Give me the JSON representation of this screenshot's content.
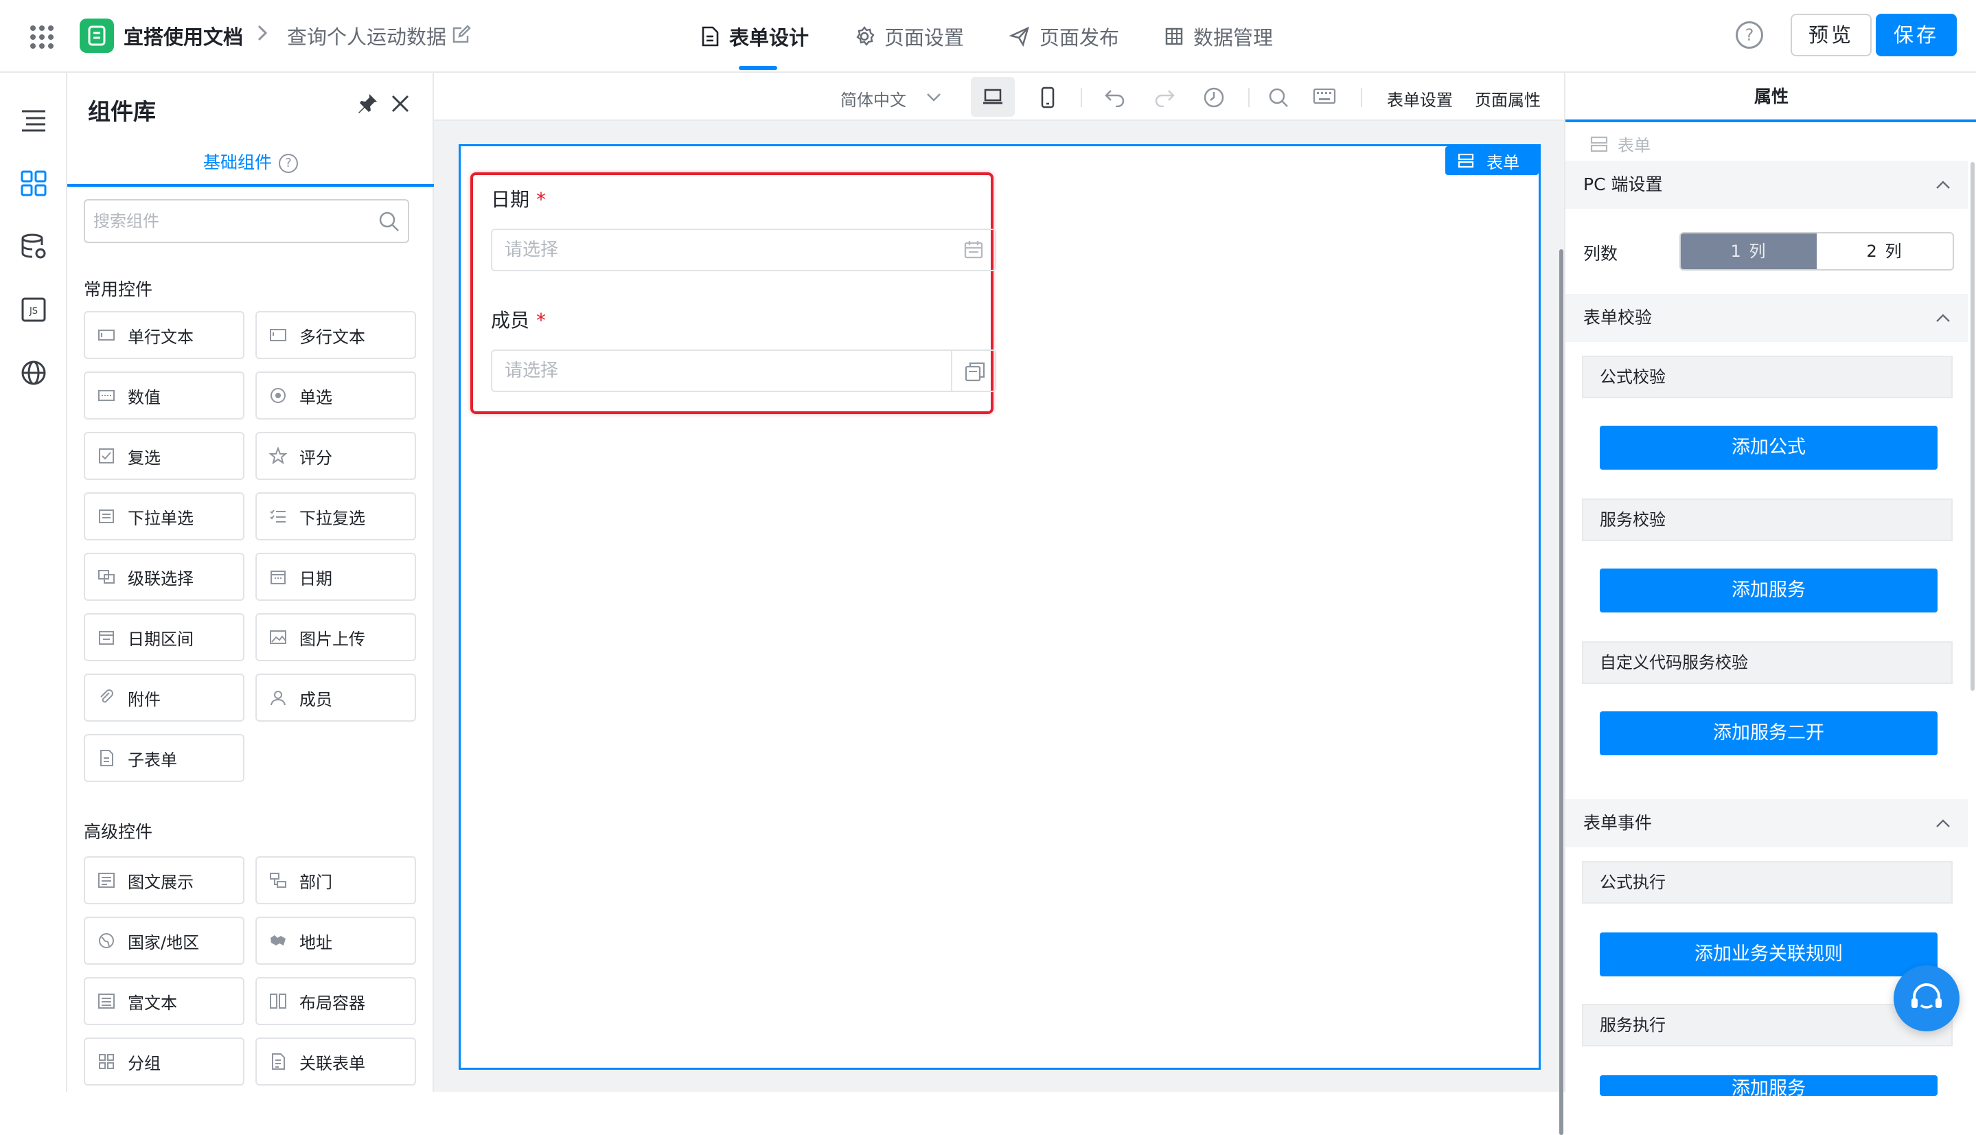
{
  "header": {
    "app_name": "宜搭使用文档",
    "breadcrumb_sep": ">",
    "page_name": "查询个人运动数据",
    "tabs": [
      {
        "label": "表单设计",
        "icon": "document-icon"
      },
      {
        "label": "页面设置",
        "icon": "gear-icon"
      },
      {
        "label": "页面发布",
        "icon": "send-icon"
      },
      {
        "label": "数据管理",
        "icon": "table-icon"
      }
    ],
    "help": "?",
    "preview_label": "预览",
    "save_label": "保存"
  },
  "rail": {
    "icons": [
      "outline-icon",
      "components-icon",
      "datasource-icon",
      "js-icon",
      "globe-icon"
    ]
  },
  "components": {
    "title": "组件库",
    "tab": "基础组件",
    "search_placeholder": "搜索组件",
    "common_title": "常用控件",
    "common": [
      {
        "label": "单行文本",
        "icon": "text-input-icon"
      },
      {
        "label": "多行文本",
        "icon": "textarea-icon"
      },
      {
        "label": "数值",
        "icon": "number-icon"
      },
      {
        "label": "单选",
        "icon": "radio-icon"
      },
      {
        "label": "复选",
        "icon": "checkbox-icon"
      },
      {
        "label": "评分",
        "icon": "star-icon"
      },
      {
        "label": "下拉单选",
        "icon": "select-icon"
      },
      {
        "label": "下拉复选",
        "icon": "multi-select-icon"
      },
      {
        "label": "级联选择",
        "icon": "cascade-icon"
      },
      {
        "label": "日期",
        "icon": "calendar-icon"
      },
      {
        "label": "日期区间",
        "icon": "date-range-icon"
      },
      {
        "label": "图片上传",
        "icon": "image-icon"
      },
      {
        "label": "附件",
        "icon": "attachment-icon"
      },
      {
        "label": "成员",
        "icon": "user-icon"
      },
      {
        "label": "子表单",
        "icon": "subform-icon"
      }
    ],
    "advanced_title": "高级控件",
    "advanced": [
      {
        "label": "图文展示",
        "icon": "image-text-icon"
      },
      {
        "label": "部门",
        "icon": "department-icon"
      },
      {
        "label": "国家/地区",
        "icon": "globe-icon"
      },
      {
        "label": "地址",
        "icon": "map-icon"
      },
      {
        "label": "富文本",
        "icon": "richtext-icon"
      },
      {
        "label": "布局容器",
        "icon": "layout-icon"
      },
      {
        "label": "分组",
        "icon": "group-icon"
      },
      {
        "label": "关联表单",
        "icon": "link-form-icon"
      }
    ]
  },
  "toolbar": {
    "language": "简体中文",
    "form_settings": "表单设置",
    "page_props": "页面属性"
  },
  "canvas": {
    "form_tag": "表单",
    "fields": [
      {
        "label": "日期",
        "required": "*",
        "placeholder": "请选择",
        "icon": "calendar-icon"
      },
      {
        "label": "成员",
        "required": "*",
        "placeholder": "请选择",
        "icon": "member-picker-icon"
      }
    ]
  },
  "props": {
    "tab": "属性",
    "crumb": "表单",
    "pc_settings": "PC 端设置",
    "columns_label": "列数",
    "columns_options": [
      "1 列",
      "2 列"
    ],
    "columns_selected": "1 列",
    "validation_title": "表单校验",
    "formula_check": "公式校验",
    "add_formula": "添加公式",
    "service_check": "服务校验",
    "add_service": "添加服务",
    "custom_code_check": "自定义代码服务校验",
    "add_service_two": "添加服务二开",
    "events_title": "表单事件",
    "formula_exec": "公式执行",
    "add_rule": "添加业务关联规则",
    "service_exec": "服务执行",
    "add_service_exec": "添加服务"
  },
  "colors": {
    "primary": "#0089ff",
    "highlight": "#e5202e",
    "app_logo": "#1fb86a",
    "segment_selected": "#79859a"
  }
}
